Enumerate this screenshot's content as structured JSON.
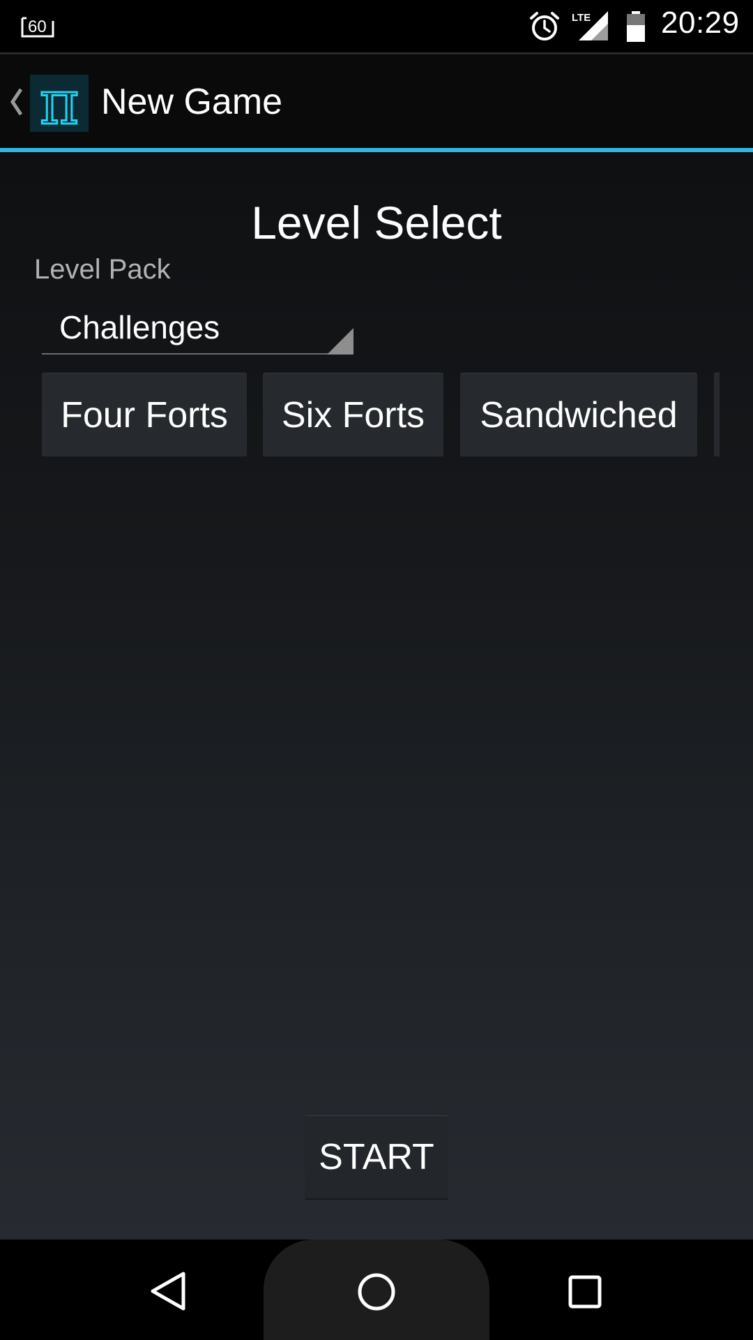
{
  "status_bar": {
    "left_icon": "fps-60-icon",
    "left_icon_text": "60",
    "network_label": "LTE",
    "time": "20:29",
    "icons": [
      "alarm-icon",
      "lte-signal-icon",
      "battery-icon"
    ]
  },
  "action_bar": {
    "title": "New Game",
    "logo": "pi-logo-icon",
    "logo_glyph": "π",
    "accent_color": "#33b5e5"
  },
  "main": {
    "heading": "Level Select",
    "level_pack_label": "Level Pack",
    "level_pack_selected": "Challenges",
    "levels": [
      {
        "label": "Four Forts"
      },
      {
        "label": "Six Forts"
      },
      {
        "label": "Sandwiched"
      },
      {
        "label": ""
      }
    ],
    "start_label": "START"
  },
  "nav_bar": {
    "icons": [
      "back-icon",
      "home-icon",
      "recent-apps-icon"
    ]
  }
}
